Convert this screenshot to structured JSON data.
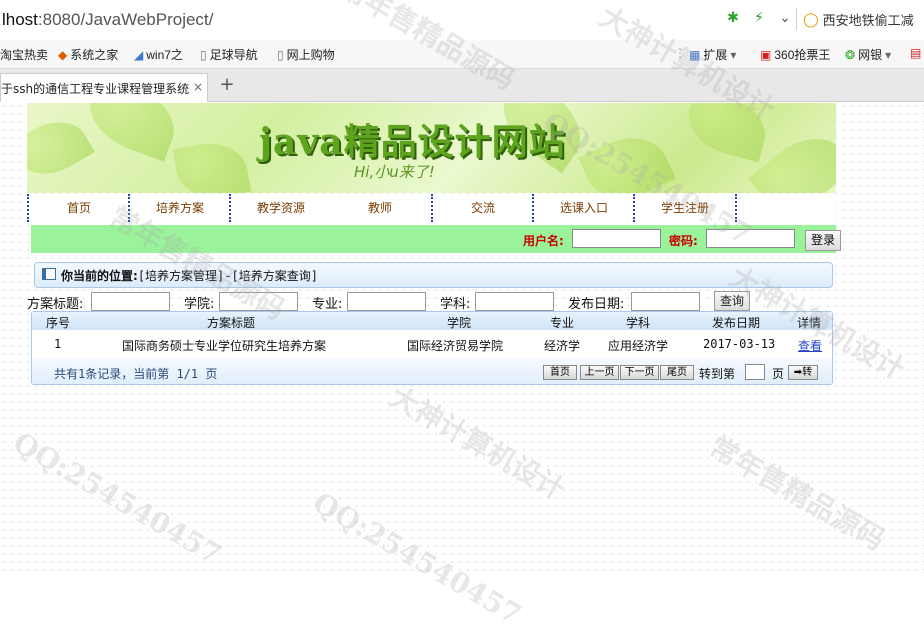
{
  "browser": {
    "url_prefix": "lhost",
    "url_rest": ":8080/JavaWebProject/",
    "search_text": "西安地铁偷工减",
    "bookmarks": [
      "淘宝热卖",
      "系统之家",
      "win7之",
      "足球导航",
      "网上购物"
    ],
    "extensions": [
      "扩展",
      "360抢票王",
      "网银"
    ],
    "tab_title": "于ssh的通信工程专业课程管理系统",
    "tab_close": "×",
    "new_tab": "+"
  },
  "site": {
    "title": "java精品设计网站",
    "subtitle": "Hi,小u来了!",
    "nav": [
      "首页",
      "培养方案",
      "教学资源",
      "教师",
      "交流",
      "选课入口",
      "学生注册"
    ],
    "login": {
      "username_label": "用户名:",
      "password_label": "密码:",
      "login_button": "登录"
    }
  },
  "location": {
    "label": "你当前的位置:",
    "path": "[培养方案管理]-[培养方案查询]"
  },
  "filters": {
    "title_label": "方案标题:",
    "college_label": "学院:",
    "major_label": "专业:",
    "subject_label": "学科:",
    "date_label": "发布日期:",
    "query_button": "查询"
  },
  "table": {
    "headers": [
      "序号",
      "方案标题",
      "学院",
      "专业",
      "学科",
      "发布日期",
      "详情"
    ],
    "rows": [
      [
        "1",
        "国际商务硕士专业学位研究生培养方案",
        "国际经济贸易学院",
        "经济学",
        "应用经济学",
        "2017-03-13",
        "查看"
      ]
    ],
    "summary": "共有1条记录，当前第 1/1 页",
    "pager": {
      "first": "首页",
      "prev": "上一页",
      "next": "下一页",
      "last": "尾页",
      "goto_label": "转到第",
      "page_suffix": "页",
      "go_button": "➡转"
    }
  },
  "watermarks": [
    "常年售精品源码",
    "大神计算机设计",
    "QQ:254540457",
    "常年售精品源码",
    "大神计算机设计",
    "QQ:254540457",
    "常年售精品源码",
    "大神计算机设计",
    "QQ:254540457"
  ]
}
